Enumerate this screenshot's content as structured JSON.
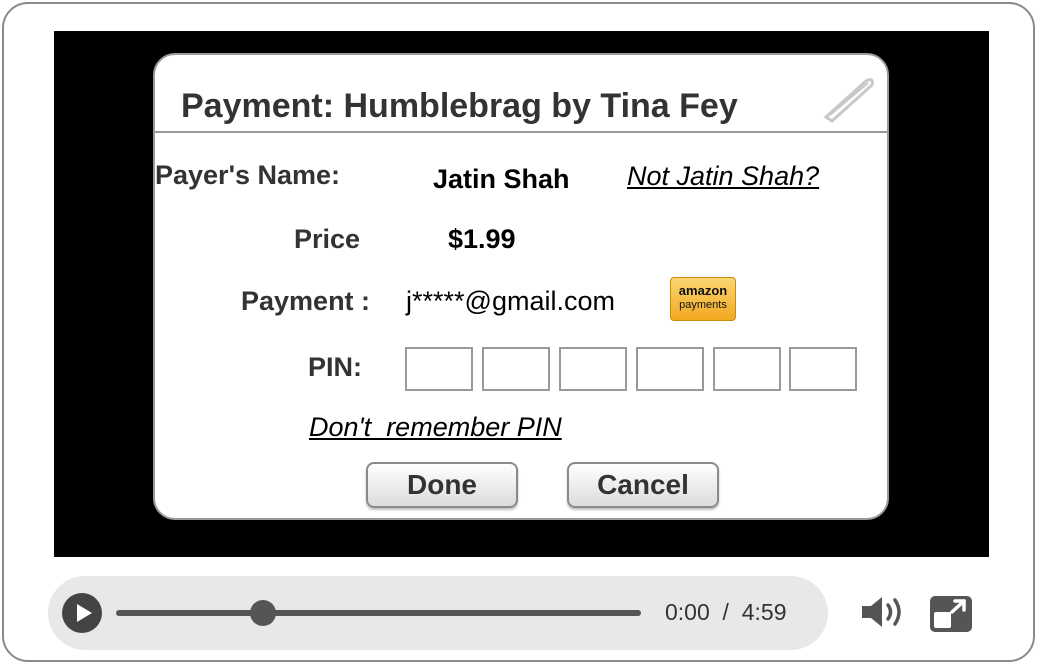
{
  "dialog": {
    "title": "Payment: Humblebrag by Tina Fey",
    "payer_label": "Payer's Name:",
    "payer_name": "Jatin Shah",
    "not_payer_link": "Not Jatin Shah?",
    "price_label": "Price",
    "price_value": "$1.99",
    "payment_label": "Payment :",
    "payment_email": "j*****@gmail.com",
    "amazon_badge": {
      "line1": "amazon",
      "line2": "payments"
    },
    "pin_label": "PIN:",
    "pin_digits": [
      "",
      "",
      "",
      "",
      "",
      ""
    ],
    "forgot_pin_link": "Don't  remember PIN",
    "done_label": "Done",
    "cancel_label": "Cancel"
  },
  "player": {
    "current_time": "0:00",
    "separator": "/",
    "duration": "4:59",
    "progress": 0.28
  },
  "colors": {
    "video_bg": "#000000",
    "amazon_badge": "#f2a81e",
    "controls": "#444444"
  },
  "icons": [
    "pen-icon",
    "play-icon",
    "volume-icon",
    "fullscreen-icon"
  ]
}
